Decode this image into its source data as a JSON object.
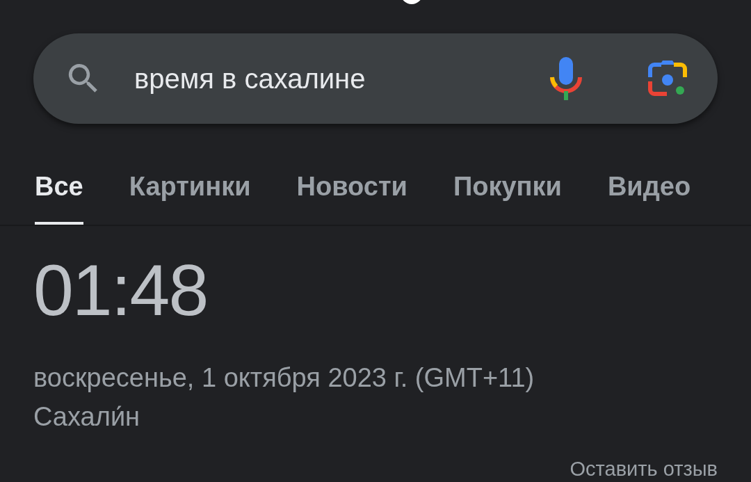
{
  "search": {
    "query": "время в сахалине"
  },
  "tabs": [
    {
      "label": "Все",
      "selected": true
    },
    {
      "label": "Картинки",
      "selected": false
    },
    {
      "label": "Новости",
      "selected": false
    },
    {
      "label": "Покупки",
      "selected": false
    },
    {
      "label": "Видео",
      "selected": false
    }
  ],
  "result": {
    "time": "01:48",
    "date": "воскресенье, 1 октября 2023 г. (GMT+11)",
    "place": "Сахали́н",
    "feedback_link": "Оставить отзыв"
  }
}
